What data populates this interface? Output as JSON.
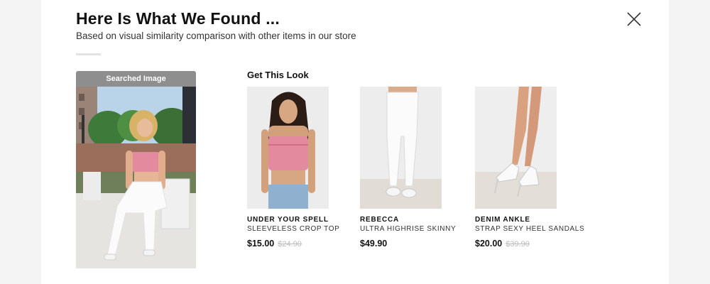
{
  "header": {
    "title": "Here Is What We Found ...",
    "subtitle": "Based on visual similarity comparison with other items in our store"
  },
  "close_icon": "close-icon",
  "searched": {
    "label": "Searched Image"
  },
  "look": {
    "heading": "Get This Look",
    "products": [
      {
        "name": "UNDER YOUR SPELL",
        "desc": "SLEEVELESS CROP TOP",
        "price": "$15.00",
        "old_price": "$24.90"
      },
      {
        "name": "REBECCA",
        "desc": "ULTRA HIGHRISE SKINNY",
        "price": "$49.90",
        "old_price": ""
      },
      {
        "name": "DENIM ANKLE",
        "desc": "STRAP SEXY HEEL SANDALS",
        "price": "$20.00",
        "old_price": "$39.90"
      }
    ]
  },
  "colors": {
    "label_bg": "#8e8e8e",
    "old_price": "#bcbcbc",
    "top_pink": "#e48a9e"
  }
}
